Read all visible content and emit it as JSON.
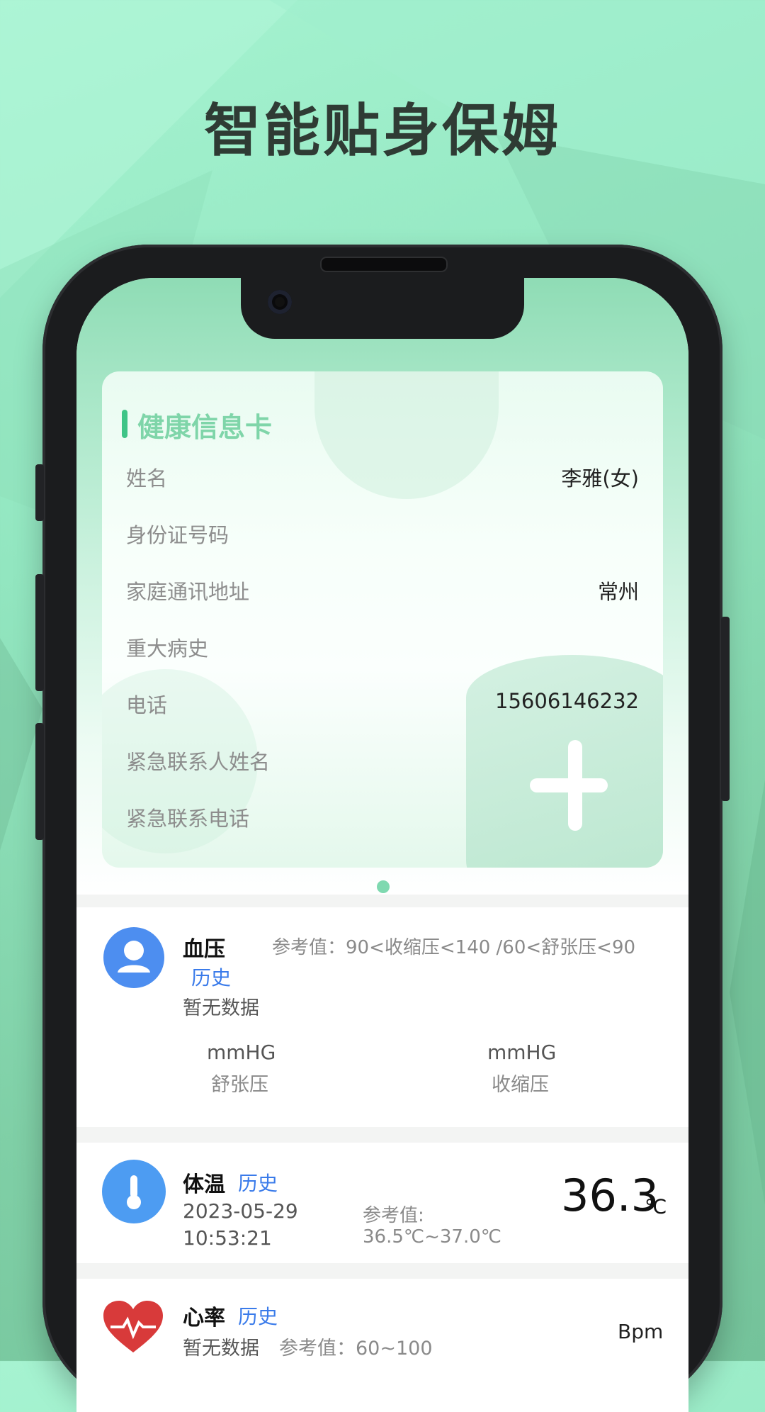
{
  "headline": "智能贴身保姆",
  "health_card": {
    "title": "健康信息卡",
    "rows": [
      {
        "label": "姓名",
        "value": "李雅(女)"
      },
      {
        "label": "身份证号码",
        "value": ""
      },
      {
        "label": "家庭通讯地址",
        "value": "常州"
      },
      {
        "label": "重大病史",
        "value": ""
      },
      {
        "label": "电话",
        "value": "15606146232"
      },
      {
        "label": "紧急联系人姓名",
        "value": ""
      },
      {
        "label": "紧急联系电话",
        "value": ""
      }
    ]
  },
  "blood_pressure": {
    "title": "血压",
    "reference": "参考值：90<收缩压<140 /60<舒张压<90",
    "history": "历史",
    "status": "暂无数据",
    "diastolic_unit": "mmHG",
    "diastolic_label": "舒张压",
    "systolic_unit": "mmHG",
    "systolic_label": "收缩压"
  },
  "temperature": {
    "title": "体温",
    "history": "历史",
    "date": "2023-05-29",
    "time": "10:53:21",
    "reference_label": "参考值:",
    "reference_range": "36.5℃~37.0℃",
    "value": "36.3",
    "unit": "℃"
  },
  "heart_rate": {
    "title": "心率",
    "history": "历史",
    "status": "暂无数据",
    "reference": "参考值：60~100",
    "unit": "Bpm"
  },
  "colors": {
    "accent_green": "#3fc487",
    "link_blue": "#3a7bea",
    "icon_blue": "#4d8ef0",
    "heart_red": "#d83a3a"
  }
}
